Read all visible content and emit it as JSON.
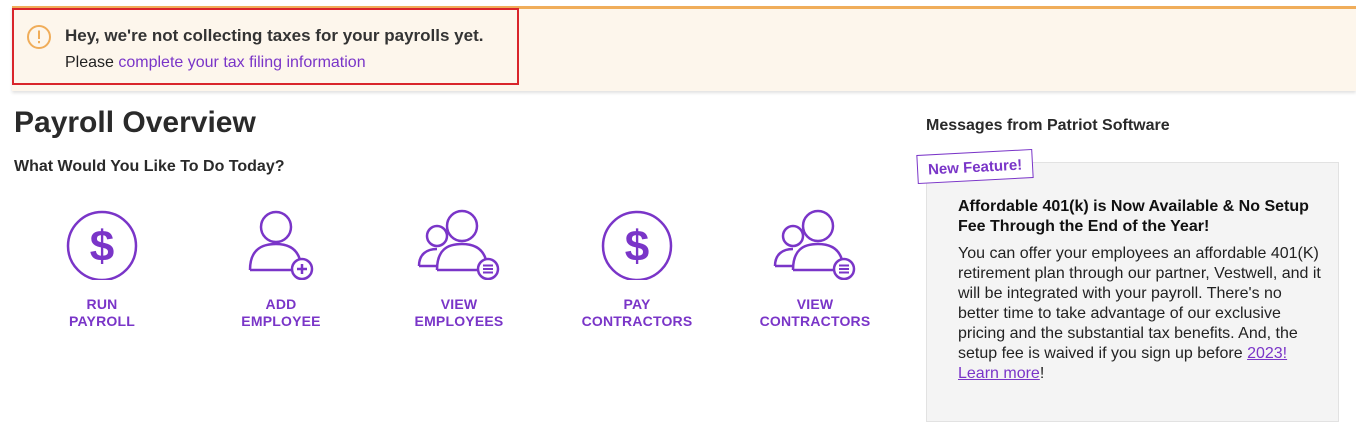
{
  "alert": {
    "title": "Hey, we're not collecting taxes for your payrolls yet.",
    "prefix": "Please ",
    "link": "complete your tax filing information"
  },
  "page": {
    "title": "Payroll Overview",
    "subtitle": "What Would You Like To Do Today?"
  },
  "actions": [
    {
      "line1": "RUN",
      "line2": "PAYROLL",
      "icon": "dollar-icon"
    },
    {
      "line1": "ADD",
      "line2": "EMPLOYEE",
      "icon": "add-person-icon"
    },
    {
      "line1": "VIEW",
      "line2": "EMPLOYEES",
      "icon": "people-list-icon"
    },
    {
      "line1": "PAY",
      "line2": "CONTRACTORS",
      "icon": "dollar-icon"
    },
    {
      "line1": "VIEW",
      "line2": "CONTRACTORS",
      "icon": "people-list-icon"
    }
  ],
  "messages": {
    "title": "Messages from Patriot Software",
    "badge": "New Feature!",
    "headline": "Affordable 401(k) is Now Available & No Setup Fee Through the End of the Year!",
    "body": "You can offer your employees an affordable 401(K) retirement plan through our partner, Vestwell, and it will be integrated with your payroll. There's no better time to take advantage of our exclusive pricing and the substantial tax benefits. And, the setup fee is waived if you sign up before ",
    "year_link": "2023!",
    "learn_more": "Learn more",
    "suffix": "!"
  },
  "colors": {
    "accent": "#7a35c8",
    "alert_bg": "#fdf6ec",
    "alert_border": "#f0ad5a",
    "highlight": "#d9252b"
  }
}
